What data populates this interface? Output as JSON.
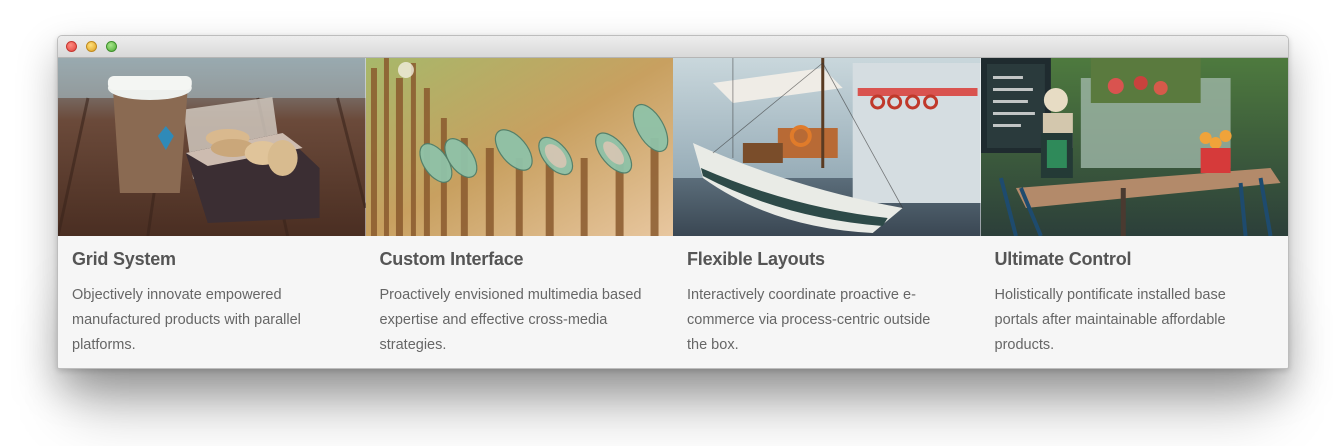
{
  "window": {
    "traffic_lights": [
      "close",
      "minimize",
      "maximize"
    ]
  },
  "features": [
    {
      "title": "Grid System",
      "description": "Objectively innovate empowered manufactured products with parallel platforms.",
      "image": "coffee-cup-and-cookies-photo"
    },
    {
      "title": "Custom Interface",
      "description": "Proactively envisioned multimedia based expertise and effective cross-media strategies.",
      "image": "glass-bottles-on-fence-photo"
    },
    {
      "title": "Flexible Layouts",
      "description": "Interactively coordinate proactive e-commerce via process-centric outside the box.",
      "image": "sailboat-in-harbor-photo"
    },
    {
      "title": "Ultimate Control",
      "description": "Holistically pontificate installed base portals after maintainable affordable products.",
      "image": "outdoor-cafe-terrace-photo"
    }
  ]
}
